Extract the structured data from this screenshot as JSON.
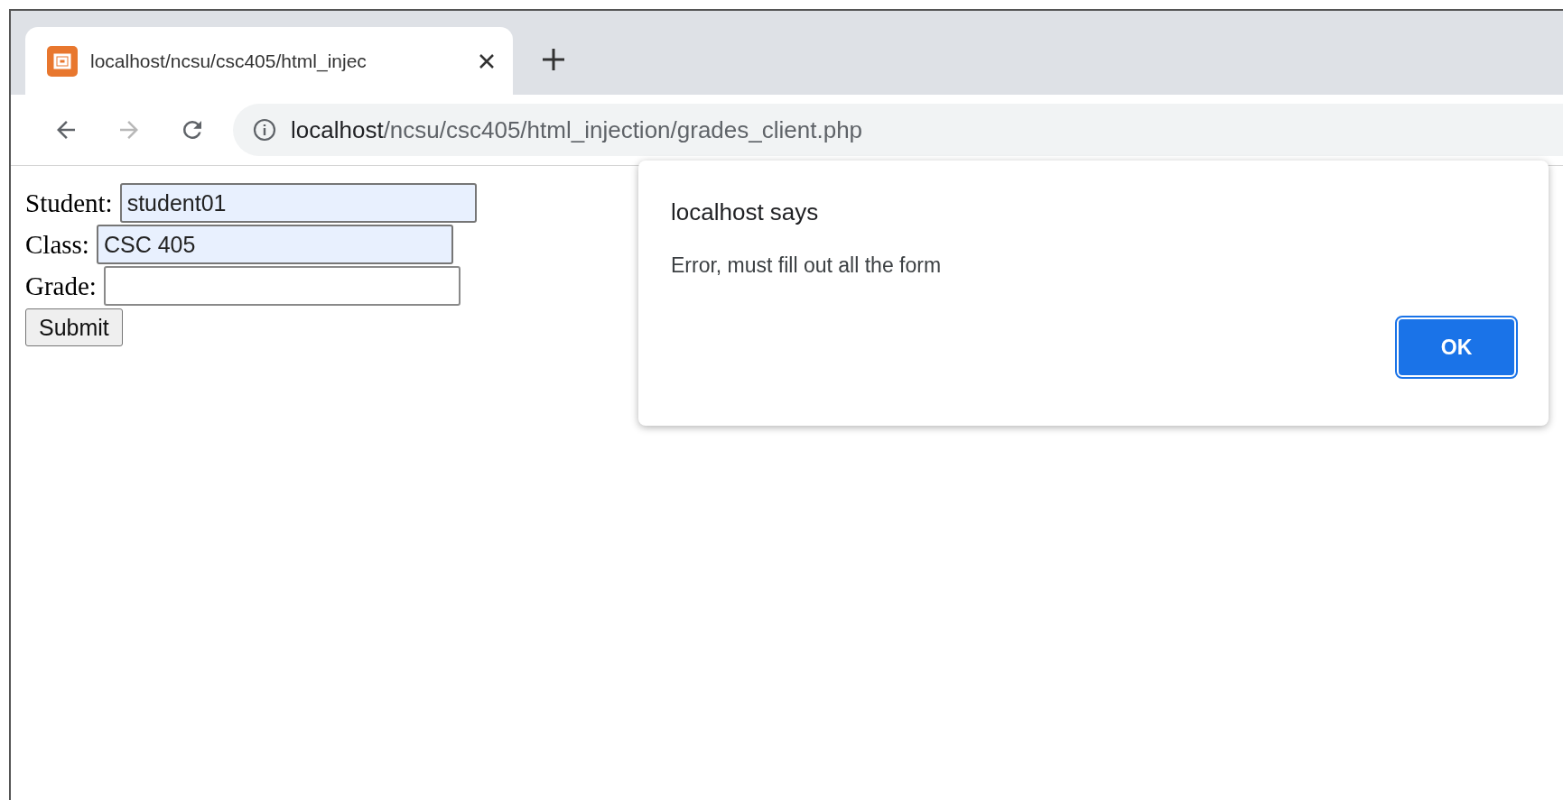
{
  "tab": {
    "title": "localhost/ncsu/csc405/html_injec",
    "selected": true
  },
  "toolbar": {
    "back_disabled": false,
    "forward_disabled": true
  },
  "address": {
    "host": "localhost",
    "path": "/ncsu/csc405/html_injection/grades_client.php"
  },
  "form": {
    "fields": [
      {
        "label": "Student:",
        "value": "student01",
        "autofilled": true
      },
      {
        "label": "Class:",
        "value": "CSC 405",
        "autofilled": true
      },
      {
        "label": "Grade:",
        "autofilled": false
      }
    ],
    "submit": "Submit"
  },
  "dialog": {
    "title": "localhost says",
    "message": "Error, must fill out all the form",
    "button": "OK"
  }
}
